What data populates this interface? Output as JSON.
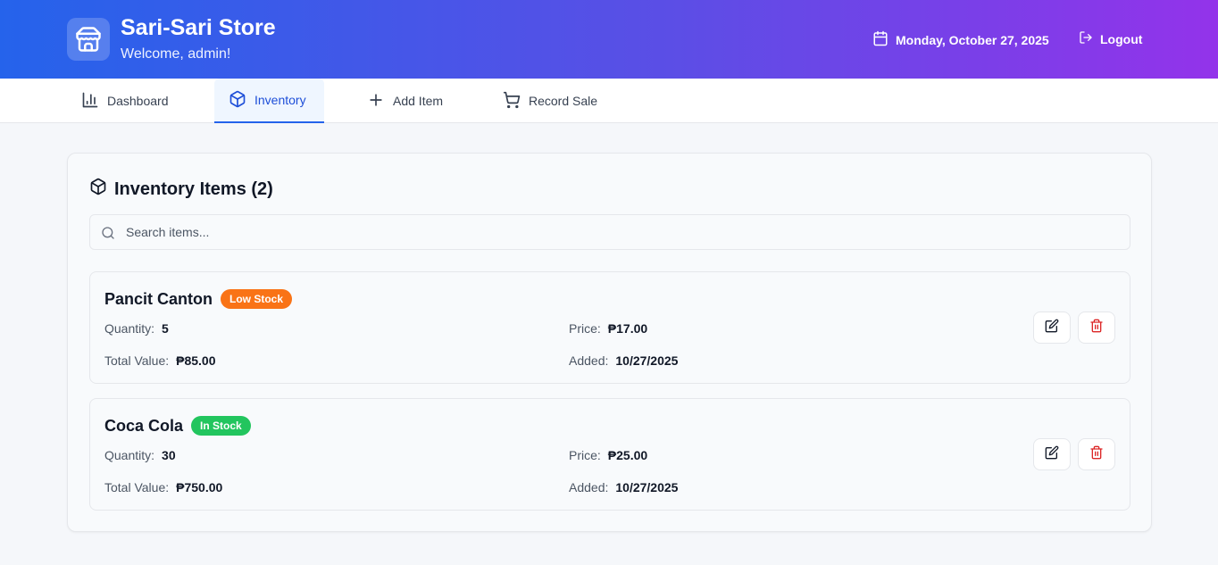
{
  "header": {
    "title": "Sari-Sari Store",
    "welcome": "Welcome, admin!",
    "date": "Monday, October 27, 2025",
    "logout_label": "Logout",
    "icons": {
      "logo": "store-icon",
      "date": "calendar-icon",
      "logout": "logout-icon"
    }
  },
  "nav": {
    "tabs": [
      {
        "label": "Dashboard",
        "icon": "bar-chart-icon",
        "active": false
      },
      {
        "label": "Inventory",
        "icon": "package-icon",
        "active": true
      },
      {
        "label": "Add Item",
        "icon": "plus-icon",
        "active": false
      },
      {
        "label": "Record Sale",
        "icon": "cart-icon",
        "active": false
      }
    ]
  },
  "inventory": {
    "title": "Inventory Items (2)",
    "search": {
      "placeholder": "Search items...",
      "value": ""
    },
    "labels": {
      "quantity": "Quantity:",
      "price": "Price:",
      "total_value": "Total Value:",
      "added": "Added:"
    },
    "items": [
      {
        "name": "Pancit Canton",
        "badge": "Low Stock",
        "badge_color": "#f97316",
        "quantity": "5",
        "price": "₱17.00",
        "total_value": "₱85.00",
        "added": "10/27/2025"
      },
      {
        "name": "Coca Cola",
        "badge": "In Stock",
        "badge_color": "#22c55e",
        "quantity": "30",
        "price": "₱25.00",
        "total_value": "₱750.00",
        "added": "10/27/2025"
      }
    ]
  },
  "colors": {
    "header_gradient_start": "#2563eb",
    "header_gradient_end": "#9333ea",
    "active_tab": "#1d4ed8",
    "delete_icon": "#dc2626"
  }
}
